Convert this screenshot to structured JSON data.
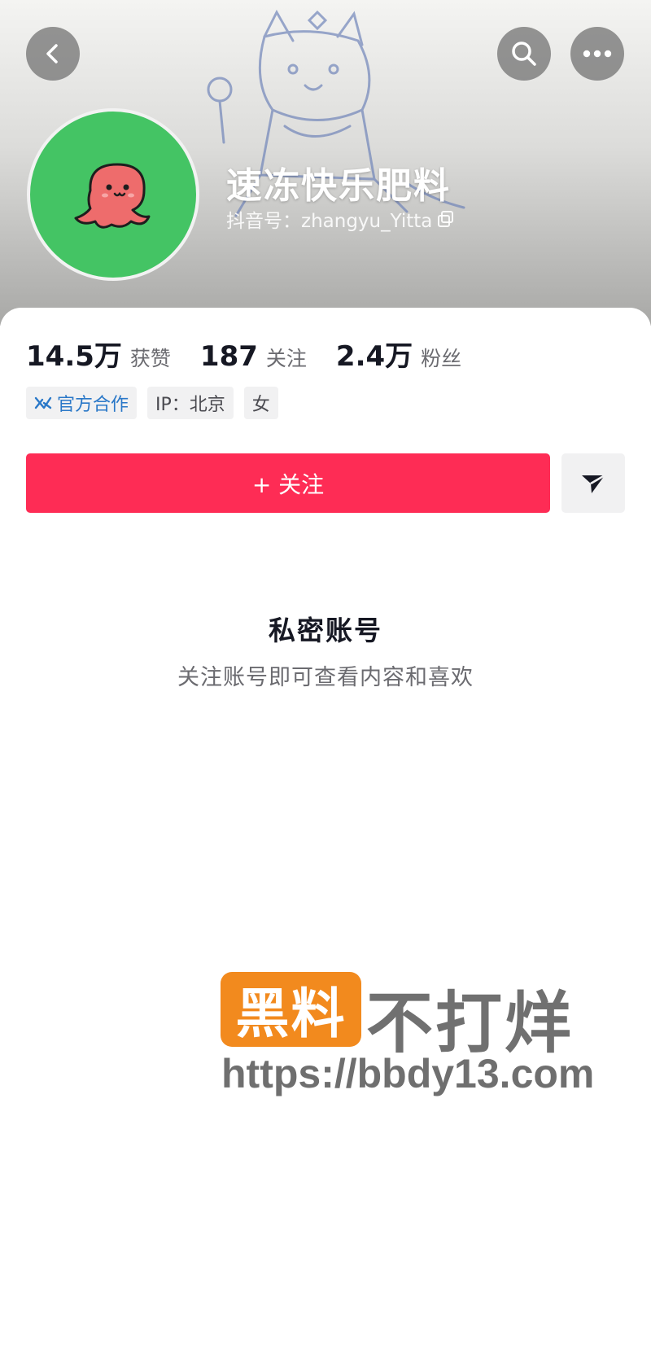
{
  "header": {
    "back_icon": "chevron-left-icon",
    "search_icon": "search-icon",
    "more_icon": "ellipsis-icon",
    "avatar_icon": "octopus-avatar-icon"
  },
  "profile": {
    "name": "速冻快乐肥料",
    "id_label": "抖音号：zhangyu_Yitta",
    "copy_icon": "copy-icon"
  },
  "stats": [
    {
      "value": "14.5万",
      "label": "获赞"
    },
    {
      "value": "187",
      "label": "关注"
    },
    {
      "value": "2.4万",
      "label": "粉丝"
    }
  ],
  "tags": [
    {
      "label": "官方合作",
      "icon": "official-cooperation-icon"
    },
    {
      "label": "IP：北京"
    },
    {
      "label": "女"
    }
  ],
  "actions": {
    "follow_label": "+ 关注",
    "share_icon": "send-icon"
  },
  "private_notice": {
    "title": "私密账号",
    "description": "关注账号即可查看内容和喜欢"
  },
  "watermark": {
    "badge": "黑料",
    "text": "不打烊",
    "url": "https://bbdy13.com"
  },
  "colors": {
    "follow_button": "#fe2c55",
    "avatar_bg": "#44c464",
    "watermark_badge": "#f28a1e",
    "official_tag_text": "#2a78c8"
  }
}
